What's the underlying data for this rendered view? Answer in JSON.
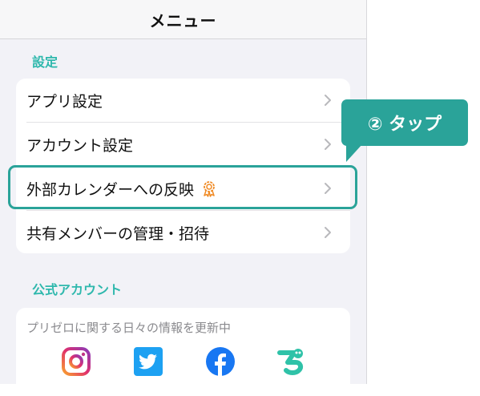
{
  "navbar": {
    "title": "メニュー"
  },
  "sections": {
    "settings_label": "設定",
    "official_label": "公式アカウント"
  },
  "settings_items": [
    {
      "label": "アプリ設定"
    },
    {
      "label": "アカウント設定"
    },
    {
      "label": "外部カレンダーへの反映",
      "icon": "award-badge-icon"
    },
    {
      "label": "共有メンバーの管理・招待"
    }
  ],
  "callout": {
    "text": "② タップ"
  },
  "official": {
    "description": "プリゼロに関する日々の情報を更新中",
    "icons": [
      "instagram-icon",
      "twitter-icon",
      "facebook-icon",
      "app-character-icon"
    ]
  },
  "colors": {
    "accent": "#2fb8ad",
    "callout": "#2aa399",
    "badge": "#f08a24",
    "twitter": "#1da1f2",
    "facebook": "#1877f2"
  }
}
